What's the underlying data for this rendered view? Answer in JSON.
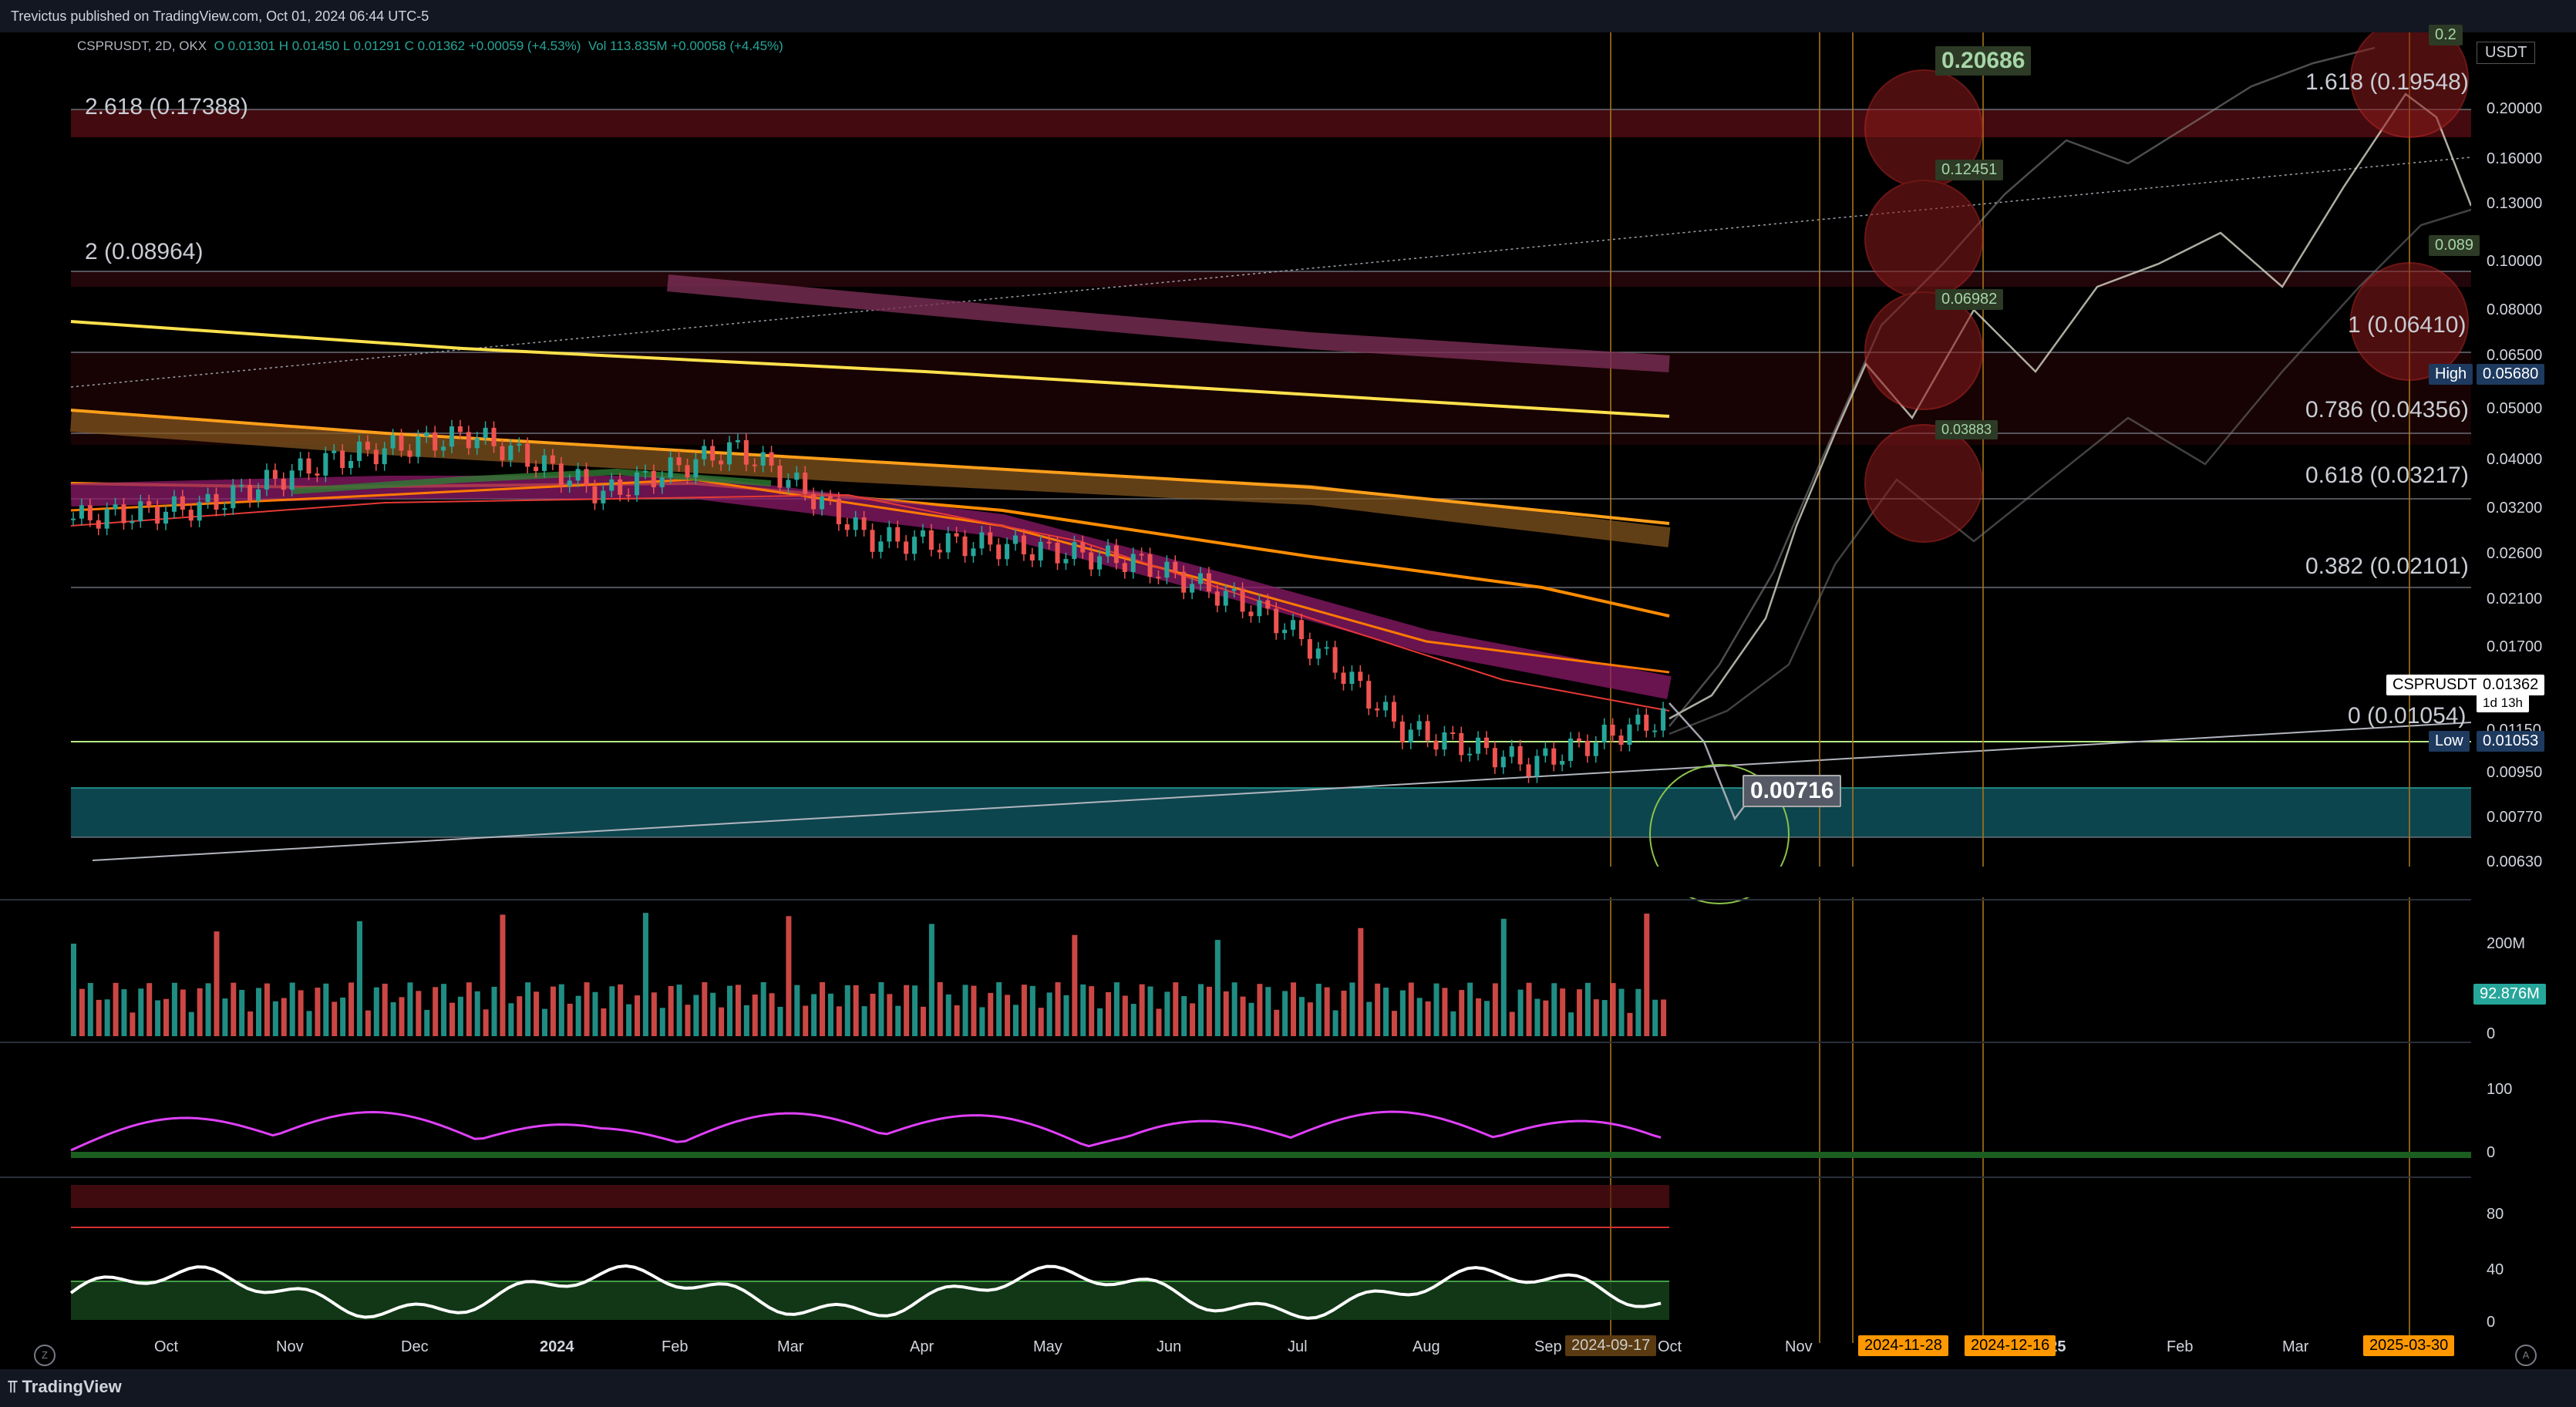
{
  "header": {
    "published": "Trevictus published on TradingView.com, Oct 01, 2024 06:44 UTC-5"
  },
  "footer": {
    "brand": "TradingView"
  },
  "legend": {
    "symbol": "CSPRUSDT, 2D, OKX",
    "ohlc": "O 0.01301  H 0.01450  L 0.01291  C 0.01362  +0.00059 (+4.53%)",
    "vol": "Vol 113.835M  +0.00058 (+4.45%)"
  },
  "price_axis": {
    "unit": "USDT",
    "ticks": [
      "0.20000",
      "0.16000",
      "0.13000",
      "0.10000",
      "0.08000",
      "0.06500",
      "0.05000",
      "0.04000",
      "0.03200",
      "0.02600",
      "0.02100",
      "0.01700",
      "0.01150",
      "0.00950",
      "0.00770",
      "0.00630"
    ],
    "high_tag": "High",
    "high_value": "0.05680",
    "low_tag": "Low",
    "low_value": "0.01053",
    "symbol_tag": "CSPRUSDT",
    "last_price": "0.01362",
    "countdown": "1d 13h"
  },
  "fib_labels": [
    {
      "text": "2.618 (0.17388)"
    },
    {
      "text": "2 (0.08964)"
    },
    {
      "text": "1.618 (0.19548)"
    },
    {
      "text": "1 (0.06410)"
    },
    {
      "text": "0.786 (0.04356)"
    },
    {
      "text": "0.618 (0.03217)"
    },
    {
      "text": "0.382 (0.02101)"
    },
    {
      "text": "0 (0.01054)"
    }
  ],
  "projection_labels": [
    "0.20686",
    "0.12451",
    "0.06982",
    "0.03883",
    "0.00716",
    "0.089",
    "0.2"
  ],
  "volume_axis": {
    "tick": "200M",
    "zero": "0",
    "current": "92.876M"
  },
  "osc_axis": {
    "ticks": [
      "100",
      "0"
    ]
  },
  "rsi_axis": {
    "ticks": [
      "80",
      "40",
      "0"
    ]
  },
  "time_axis": {
    "labels": [
      "Oct",
      "Nov",
      "Dec",
      "2024",
      "Feb",
      "Mar",
      "Apr",
      "May",
      "Jun",
      "Jul",
      "Aug",
      "Sep",
      "Oct",
      "Nov",
      "2025",
      "Feb",
      "Mar"
    ],
    "highlighted": [
      "2024-09-17",
      "2024-11-28",
      "2024-12-16",
      "2025-03-30"
    ]
  },
  "chart_data": {
    "type": "candlestick",
    "symbol": "CSPRUSDT",
    "interval": "2D",
    "exchange": "OKX",
    "approx_close": [
      {
        "date": "2023-10",
        "close": 0.034
      },
      {
        "date": "2023-11",
        "close": 0.036
      },
      {
        "date": "2023-12",
        "close": 0.045
      },
      {
        "date": "2024-01",
        "close": 0.05
      },
      {
        "date": "2024-02",
        "close": 0.038
      },
      {
        "date": "2024-03",
        "close": 0.047
      },
      {
        "date": "2024-04",
        "close": 0.031
      },
      {
        "date": "2024-05",
        "close": 0.03
      },
      {
        "date": "2024-06",
        "close": 0.028
      },
      {
        "date": "2024-07",
        "close": 0.022
      },
      {
        "date": "2024-08",
        "close": 0.013
      },
      {
        "date": "2024-09",
        "close": 0.011
      },
      {
        "date": "2024-10-01",
        "close": 0.01362
      }
    ],
    "fib_levels": [
      {
        "ratio": 2.618,
        "price": 0.17388
      },
      {
        "ratio": 2,
        "price": 0.08964
      },
      {
        "ratio": 1.618,
        "price": 0.19548
      },
      {
        "ratio": 1,
        "price": 0.0641
      },
      {
        "ratio": 0.786,
        "price": 0.04356
      },
      {
        "ratio": 0.618,
        "price": 0.03217
      },
      {
        "ratio": 0.382,
        "price": 0.02101
      },
      {
        "ratio": 0,
        "price": 0.01054
      }
    ],
    "range_high": 0.0568,
    "range_low": 0.01053,
    "scale": "log"
  },
  "colors": {
    "bull": "#26a69a",
    "bear": "#ef5350",
    "fib_red": "#b71c1c",
    "support_teal": "#006064",
    "ma_yellow": "#ffeb3b",
    "ma_orange": "#ff9800"
  }
}
